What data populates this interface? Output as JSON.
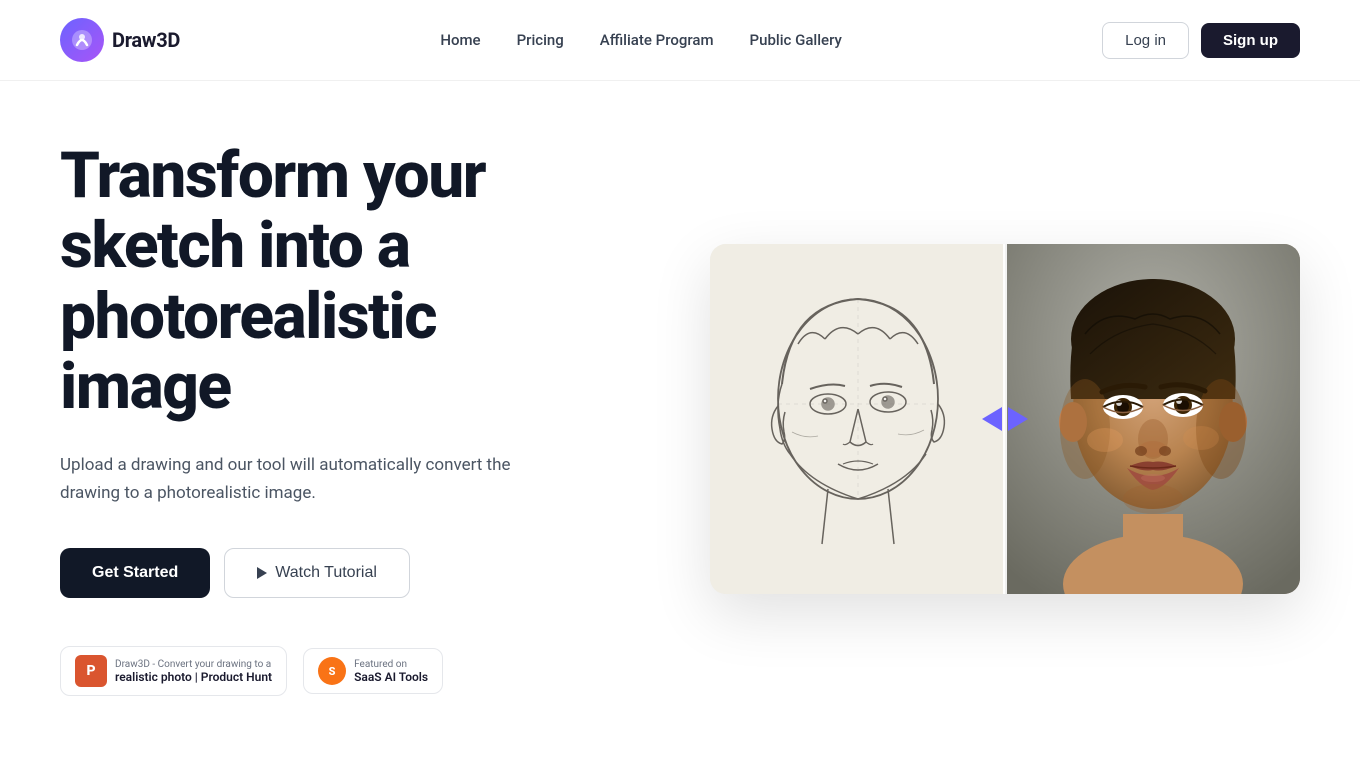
{
  "header": {
    "logo_text": "Draw3D",
    "nav": {
      "home": "Home",
      "pricing": "Pricing",
      "affiliate_program": "Affiliate Program",
      "public_gallery": "Public Gallery"
    },
    "actions": {
      "login": "Log in",
      "signup": "Sign up"
    }
  },
  "hero": {
    "title_line1": "Transform your",
    "title_line2": "sketch into a",
    "title_line3": "photorealistic image",
    "subtitle": "Upload a drawing and our tool will automatically convert the drawing to a photorealistic image.",
    "btn_get_started": "Get Started",
    "btn_watch_tutorial": "Watch Tutorial"
  },
  "badges": {
    "product_hunt": {
      "label_top": "Draw3D - Convert your drawing to a",
      "label_bottom": "realistic photo | Product Hunt"
    },
    "saas": {
      "label_top": "Featured on",
      "label_bottom": "SaaS AI Tools"
    }
  }
}
